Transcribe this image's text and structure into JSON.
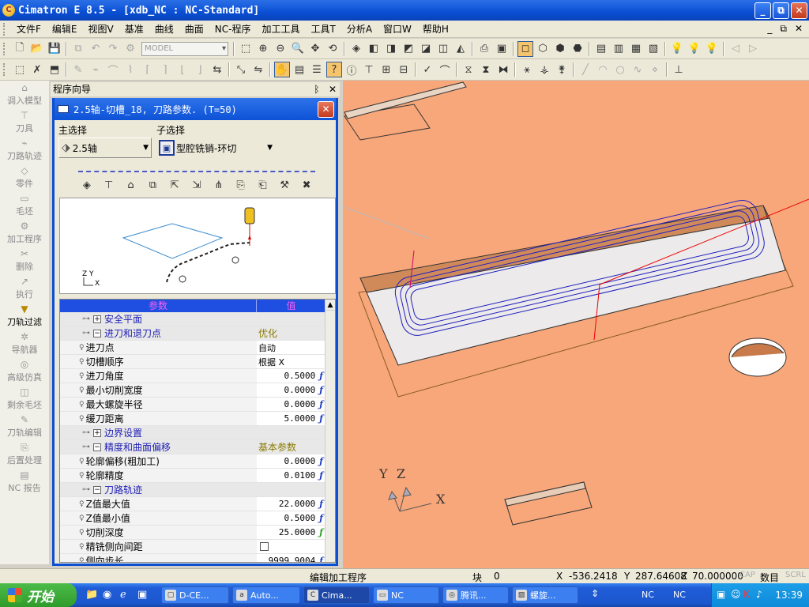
{
  "window": {
    "title": "Cimatron E 8.5 - [xdb_NC : NC-Standard]",
    "btn_min": "_",
    "btn_max": "⧉",
    "btn_close": "✕"
  },
  "menu": {
    "items": [
      "文件F",
      "编辑E",
      "视图V",
      "基准",
      "曲线",
      "曲面",
      "NC-程序",
      "加工工具",
      "工具T",
      "分析A",
      "窗口W",
      "帮助H"
    ],
    "mdi_controls": [
      "_",
      "⧉",
      "✕"
    ]
  },
  "toolbar": {
    "model_combo": "MODEL"
  },
  "sidebar": {
    "items": [
      {
        "label": "调入模型",
        "icon": "load-model-icon"
      },
      {
        "label": "刀具",
        "icon": "tool-icon"
      },
      {
        "label": "刀路轨迹",
        "icon": "toolpath-icon"
      },
      {
        "label": "零件",
        "icon": "part-icon"
      },
      {
        "label": "毛坯",
        "icon": "stock-icon"
      },
      {
        "label": "加工程序",
        "icon": "procedure-icon"
      },
      {
        "label": "删除",
        "icon": "delete-icon"
      },
      {
        "label": "执行",
        "icon": "execute-icon"
      },
      {
        "label": "刀轨过滤",
        "icon": "filter-icon",
        "active": true
      },
      {
        "label": "导航器",
        "icon": "navigator-icon"
      },
      {
        "label": "高级仿真",
        "icon": "simulation-icon"
      },
      {
        "label": "剩余毛坯",
        "icon": "remaining-stock-icon"
      },
      {
        "label": "刀轨编辑",
        "icon": "path-edit-icon"
      },
      {
        "label": "后置处理",
        "icon": "post-process-icon"
      },
      {
        "label": "NC 报告",
        "icon": "nc-report-icon"
      }
    ]
  },
  "wizard": {
    "header": "程序向导",
    "pin": "ᛒ",
    "close": "✕"
  },
  "dialog": {
    "title": "2.5轴-切槽_18, 刀路参数. (T=50)",
    "main_select_label": "主选择",
    "sub_select_label": "子选择",
    "main_select_value": "2.5轴",
    "sub_select_value": "型腔铣销-环切",
    "preview_axis": "Z Y",
    "preview_axis_x": "X"
  },
  "params": {
    "col_param": "参数",
    "col_value": "值",
    "rows": [
      {
        "type": "group",
        "toggle": "+",
        "label": "安全平面",
        "value": ""
      },
      {
        "type": "group",
        "toggle": "−",
        "label": "进刀和退刀点",
        "value": "优化"
      },
      {
        "type": "item",
        "label": "进刀点",
        "value": "自动",
        "kind": "text"
      },
      {
        "type": "item",
        "label": "切槽顺序",
        "value": "根据  X",
        "kind": "text"
      },
      {
        "type": "item",
        "label": "进刀角度",
        "value": "0.5000",
        "kind": "num"
      },
      {
        "type": "item",
        "label": "最小切削宽度",
        "value": "0.0000",
        "kind": "num"
      },
      {
        "type": "item",
        "label": "最大螺旋半径",
        "value": "0.0000",
        "kind": "num"
      },
      {
        "type": "item",
        "label": "缓刀距离",
        "value": "5.0000",
        "kind": "num"
      },
      {
        "type": "group",
        "toggle": "+",
        "label": "边界设置",
        "value": ""
      },
      {
        "type": "group",
        "toggle": "−",
        "label": "精度和曲面偏移",
        "value": "基本参数"
      },
      {
        "type": "item",
        "label": "轮廓偏移(粗加工)",
        "value": "0.0000",
        "kind": "num"
      },
      {
        "type": "item",
        "label": "轮廓精度",
        "value": "0.0100",
        "kind": "num"
      },
      {
        "type": "group",
        "toggle": "−",
        "label": "刀路轨迹",
        "value": ""
      },
      {
        "type": "item",
        "label": "Z值最大值",
        "value": "22.0000",
        "kind": "num"
      },
      {
        "type": "item",
        "label": "Z值最小值",
        "value": "0.5000",
        "kind": "num"
      },
      {
        "type": "item",
        "label": "切削深度",
        "value": "25.0000",
        "kind": "num-green"
      },
      {
        "type": "item",
        "label": "精铣侧向间距",
        "value": "",
        "kind": "check"
      },
      {
        "type": "item",
        "label": "侧向步长",
        "value": "9999.9004",
        "kind": "num"
      }
    ],
    "formula_glyph": "ƒ"
  },
  "viewport": {
    "axis_y": "Y",
    "axis_z": "Z",
    "axis_x": "X"
  },
  "status": {
    "mode": "编辑加工程序",
    "block_label": "块",
    "block_value": "0",
    "coord_x_label": "X",
    "coord_x": "-536.2418",
    "coord_y_label": "Y",
    "coord_y": "287.64608",
    "coord_z_label": "Z",
    "coord_z": "70.000000",
    "cap": "CAP",
    "num": "数目",
    "scrl": "SCRL"
  },
  "taskbar": {
    "start": "开始",
    "tasks": [
      {
        "label": "D-CE...",
        "icon": "window-icon"
      },
      {
        "label": "Auto...",
        "icon": "autocad-icon"
      },
      {
        "label": "Cima...",
        "icon": "cimatron-icon",
        "active": true
      },
      {
        "label": "NC",
        "icon": "folder-icon"
      },
      {
        "label": "腾讯...",
        "icon": "browser-icon"
      },
      {
        "label": "螺旋...",
        "icon": "image-icon"
      }
    ],
    "tray_nc1": "NC",
    "tray_nc2": "NC",
    "time": "13:39"
  }
}
